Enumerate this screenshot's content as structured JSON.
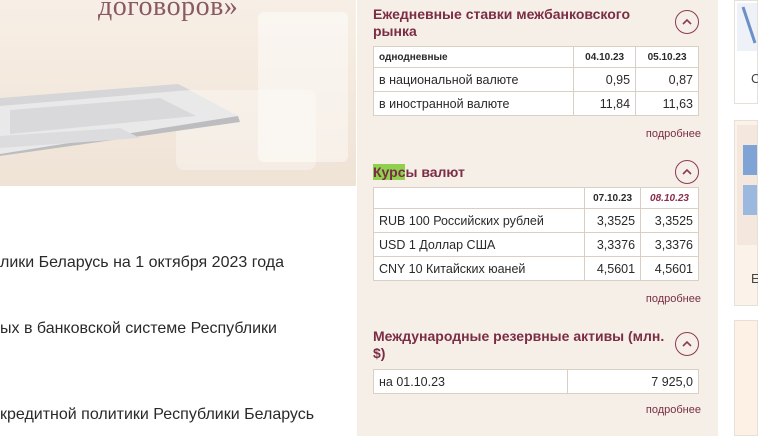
{
  "hero": {
    "title_fragment": "договоров»"
  },
  "news": {
    "items": [
      {
        "text": "лики Беларусь на 1 октября 2023 года"
      },
      {
        "text": "ых в банковской системе Республики"
      },
      {
        "text": "кредитной политики Республики Беларусь"
      }
    ]
  },
  "interbank": {
    "title_line1": "Ежедневные ставки межбанковского",
    "title_line2": "рынка",
    "header": {
      "label": "однодневные",
      "date1": "04.10.23",
      "date2": "05.10.23"
    },
    "rows": [
      {
        "label": "в национальной валюте",
        "v1": "0,95",
        "v2": "0,87"
      },
      {
        "label": "в иностранной валюте",
        "v1": "11,84",
        "v2": "11,63"
      }
    ],
    "more": "подробнее"
  },
  "rates": {
    "title_highlight": "Курс",
    "title_rest": "ы валют",
    "header": {
      "date1": "07.10.23",
      "date2": "08.10.23"
    },
    "rows": [
      {
        "label": "RUB 100 Российских рублей",
        "v1": "3,3525",
        "v2": "3,3525"
      },
      {
        "label": "USD 1 Доллар США",
        "v1": "3,3376",
        "v2": "3,3376"
      },
      {
        "label": "CNY 10 Китайских юаней",
        "v1": "4,5601",
        "v2": "4,5601"
      }
    ],
    "more": "подробнее"
  },
  "reserves": {
    "title_line1": "Международные резервные активы (млн.",
    "title_line2": "$)",
    "row": {
      "label": "на 01.10.23",
      "value": "7 925,0"
    },
    "more": "подробнее"
  },
  "right_strip": {
    "card1_letter": "С",
    "card2_letter": "Е"
  },
  "colors": {
    "accent": "#7a2d45",
    "panel_bg": "#f6efe7",
    "highlight": "#8fd14f"
  },
  "icons": [
    "chevron-up-icon"
  ]
}
